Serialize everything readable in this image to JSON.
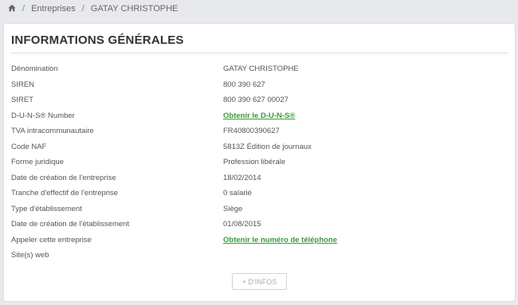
{
  "breadcrumb": {
    "home_icon": "home-icon",
    "separator": "/",
    "items": [
      "Entreprises",
      "GATAY CHRISTOPHE"
    ]
  },
  "card": {
    "title": "INFORMATIONS GÉNÉRALES",
    "rows": [
      {
        "label": "Dénomination",
        "value": "GATAY CHRISTOPHE"
      },
      {
        "label": "SIREN",
        "value": "800 390 627"
      },
      {
        "label": "SIRET",
        "value": "800 390 627 00027"
      },
      {
        "label": "D-U-N-S® Number",
        "value": "Obtenir le D-U-N-S®"
      },
      {
        "label": "TVA intracommunautaire",
        "value": "FR40800390627"
      },
      {
        "label": "Code NAF",
        "value": "5813Z Édition de journaux"
      },
      {
        "label": "Forme juridique",
        "value": "Profession libérale"
      },
      {
        "label": "Date de création de l'entreprise",
        "value": "18/02/2014"
      },
      {
        "label": "Tranche d'effectif de l'entreprise",
        "value": "0 salarié"
      },
      {
        "label": "Type d'établissement",
        "value": "Siège"
      },
      {
        "label": "Date de création de l'établissement",
        "value": "01/08/2015"
      },
      {
        "label": "Appeler cette entreprise",
        "value": "Obtenir le numéro de téléphone"
      },
      {
        "label": "Site(s) web",
        "value": ""
      }
    ],
    "more_button": "+ D'INFOS"
  },
  "colors": {
    "link": "#3a9b3a",
    "background": "#e8e9ec"
  }
}
